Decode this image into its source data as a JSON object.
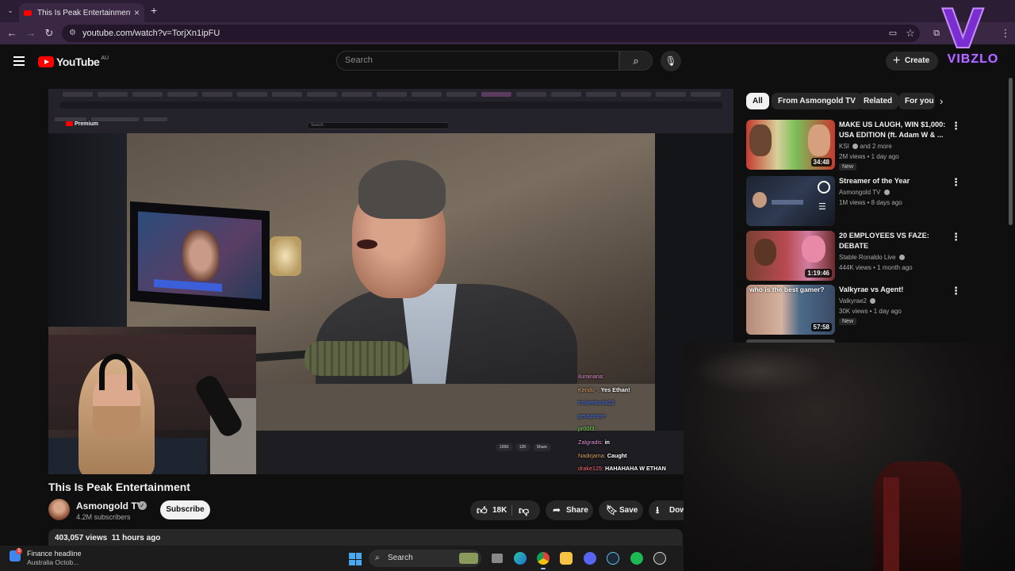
{
  "browser": {
    "tab_title": "This Is Peak Entertainment - Yo",
    "url": "youtube.com/watch?v=TorjXn1ipFU"
  },
  "youtube": {
    "logo_text": "YouTube",
    "country": "AU",
    "search_placeholder": "Search",
    "create_label": "Create"
  },
  "watermark": {
    "letter": "V",
    "text": "VIBZLO"
  },
  "video": {
    "inner_brand": "Premium",
    "inner_search": "Search",
    "chat": [
      {
        "user": "iluminaria:",
        "msg": ""
      },
      {
        "user": "Kendu_:",
        "msg": "Yes Ethan!"
      },
      {
        "user": "frostedsoda22:",
        "msg": ""
      },
      {
        "user": "geusprime:",
        "msg": ""
      },
      {
        "user": "pr00f3:",
        "msg": ""
      },
      {
        "user": "Zalgradis:",
        "msg": "in"
      },
      {
        "user": "Nadirjama:",
        "msg": "Caught"
      },
      {
        "user": "drake125:",
        "msg": "HAHAHAHA W ETHAN"
      }
    ],
    "inner_likes": "156K",
    "inner_dislike": "12K",
    "inner_share": "Share"
  },
  "watch": {
    "title": "This Is Peak Entertainment",
    "channel": "Asmongold TV",
    "subscribers": "4.2M subscribers",
    "subscribe_label": "Subscribe",
    "likes": "18K",
    "share_label": "Share",
    "save_label": "Save",
    "download_label": "Dow",
    "views": "403,057 views",
    "age": "11 hours ago"
  },
  "chips": [
    "All",
    "From Asmongold TV",
    "Related",
    "For you"
  ],
  "recommendations": [
    {
      "title": "MAKE US LAUGH, WIN $1,000: USA EDITION (ft. Adam W & ...",
      "channel": "KSI",
      "channel_extra": "and 2 more",
      "meta": "2M views • 1 day ago",
      "badge": "New",
      "duration": "34:48"
    },
    {
      "title": "Streamer of the Year",
      "channel": "Asmongold TV",
      "meta": "1M views • 8 days ago",
      "badge": "",
      "duration": ""
    },
    {
      "title": "20 EMPLOYEES VS FAZE: DEBATE",
      "channel": "Stable Ronaldo Live",
      "meta": "444K views • 1 month ago",
      "badge": "",
      "duration": "1:19:46"
    },
    {
      "title": "Valkyrae vs Agent!",
      "channel": "Valkyrae2",
      "meta": "30K views • 1 day ago",
      "badge": "New",
      "duration": "57:58",
      "thumb_text": "who is the best gamer?"
    }
  ],
  "taskbar": {
    "widget_title": "Finance headline",
    "widget_sub": "Australia Octob...",
    "widget_badge": "5",
    "search_label": "Search"
  },
  "colors": {
    "background": "#0f0f0f",
    "brand_red": "#ff0000",
    "browser_frame": "#3a2744",
    "watermark_purple": "#7a2ed0"
  },
  "icons": [
    "back-icon",
    "forward-icon",
    "reload-icon",
    "hamburger-icon",
    "search-icon",
    "mic-icon",
    "plus-icon",
    "like-icon",
    "dislike-icon",
    "share-icon",
    "save-icon",
    "download-icon",
    "more-icon",
    "chevron-right-icon",
    "windows-start-icon"
  ]
}
